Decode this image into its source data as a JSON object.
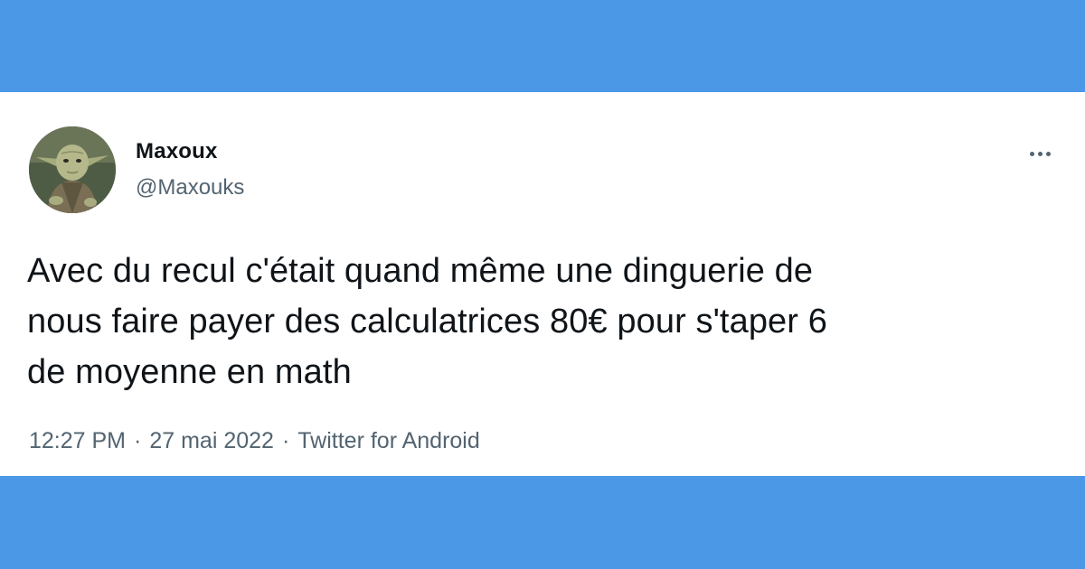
{
  "colors": {
    "background": "#4a98e6",
    "card": "#ffffff",
    "text_primary": "#0f1419",
    "text_secondary": "#536471"
  },
  "tweet": {
    "author": {
      "display_name": "Maxoux",
      "handle": "@Maxouks",
      "avatar_icon": "yoda-avatar"
    },
    "more_icon": "more-horizontal-icon",
    "text_lines": [
      "Avec du recul c'était quand même une dinguerie de",
      "nous faire payer des calculatrices 80€ pour s'taper 6",
      "de moyenne en math"
    ],
    "time": "12:27 PM",
    "separator": "·",
    "date": "27 mai 2022",
    "source": "Twitter for Android"
  }
}
